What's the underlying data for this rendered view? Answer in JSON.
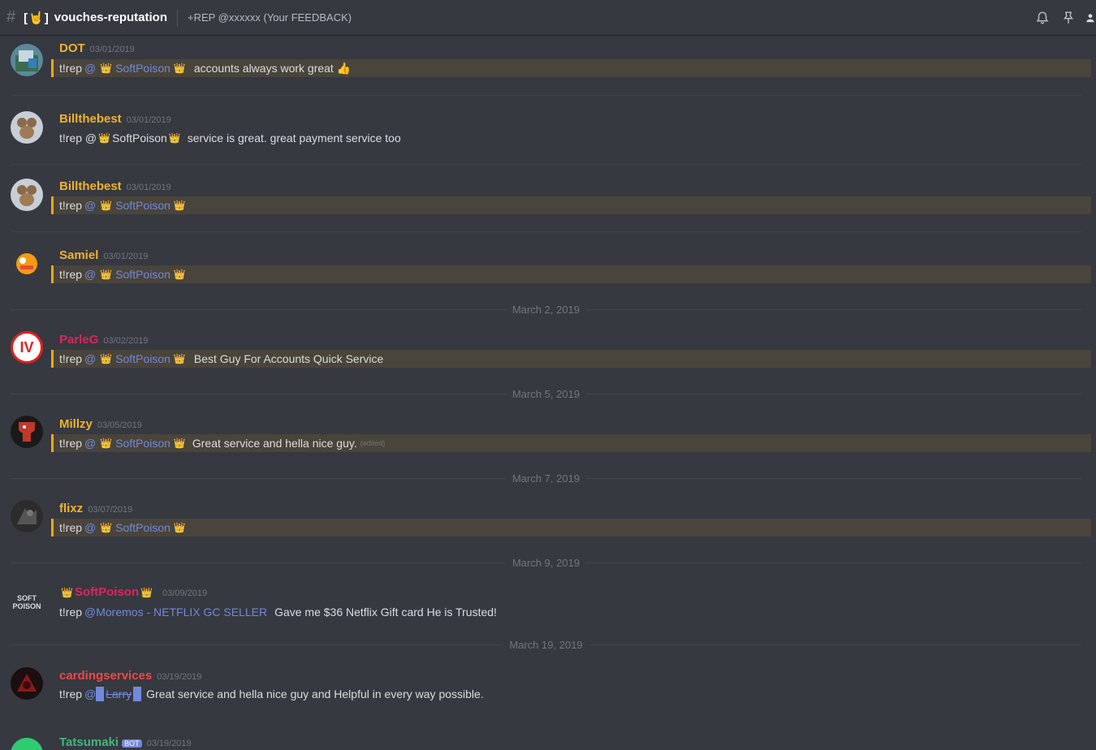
{
  "header": {
    "hash": "#",
    "channel_emoji": "[🤘]",
    "channel_name": "vouches-reputation",
    "topic": "+REP @xxxxxx (Your FEEDBACK)",
    "icons": [
      "bell-icon",
      "pin-icon",
      "members-icon"
    ]
  },
  "colors": {
    "background": "#36393f",
    "highlight_bg": "#49443c",
    "highlight_bar": "#faa61a",
    "mention": "#7289da",
    "username_gold": "#f0b232",
    "username_red": "#e0245e",
    "username_green": "#43b581"
  },
  "messages": [
    {
      "user": "DOT",
      "ts": "03/01/2019",
      "prefix": "t!rep",
      "at": "@",
      "crown1": "👑",
      "mention": "SoftPoison",
      "crown2": "👑",
      "text": "accounts always work great 👍"
    },
    {
      "user": "Billthebest",
      "ts": "03/01/2019",
      "prefix": "t!rep @",
      "crown1": "👑",
      "mention": "SoftPoison",
      "crown2": "👑",
      "text": "service is great. great payment service too"
    },
    {
      "user": "Billthebest",
      "ts": "03/01/2019",
      "prefix": "t!rep",
      "at": "@",
      "crown1": "👑",
      "mention": "SoftPoison",
      "crown2": "👑"
    },
    {
      "user": "Samiel",
      "ts": "03/01/2019",
      "prefix": "t!rep",
      "at": "@",
      "crown1": "👑",
      "mention": "SoftPoison",
      "crown2": "👑"
    },
    {
      "user": "ParleG",
      "ts": "03/02/2019",
      "prefix": "t!rep",
      "at": "@",
      "crown1": "👑",
      "mention": "SoftPoison",
      "crown2": "👑",
      "text": "Best Guy For Accounts Quick Service",
      "avatar_text": "IV"
    },
    {
      "user": "Millzy",
      "ts": "03/05/2019",
      "prefix": "t!rep",
      "at": "@",
      "crown1": "👑",
      "mention": "SoftPoison",
      "crown2": "👑",
      "text": "Great service and hella nice guy.",
      "edited": "(edited)"
    },
    {
      "user": "flixz",
      "ts": "03/07/2019",
      "prefix": "t!rep",
      "at": "@",
      "crown1": "👑",
      "mention": "SoftPoison",
      "crown2": "👑"
    },
    {
      "user": "SoftPoison",
      "ts": "03/09/2019",
      "crown1": "👑",
      "crown2": "👑",
      "prefix": "t!rep",
      "mention": "@Moremos - NETFLIX GC SELLER",
      "text": "Gave me $36 Netflix Gift card He is Trusted!",
      "avatar_text": "SOFT POISON"
    },
    {
      "user": "cardingservices",
      "ts": "03/19/2019",
      "prefix": "t!rep",
      "at": "@",
      "mention": "Larry",
      "text": "Great service and hella nice guy and Helpful in every way possible."
    },
    {
      "user": "Tatsumaki",
      "ts": "03/19/2019",
      "badge": "BOT"
    }
  ],
  "date_dividers": [
    "March 2, 2019",
    "March 5, 2019",
    "March 7, 2019",
    "March 9, 2019",
    "March 19, 2019"
  ]
}
